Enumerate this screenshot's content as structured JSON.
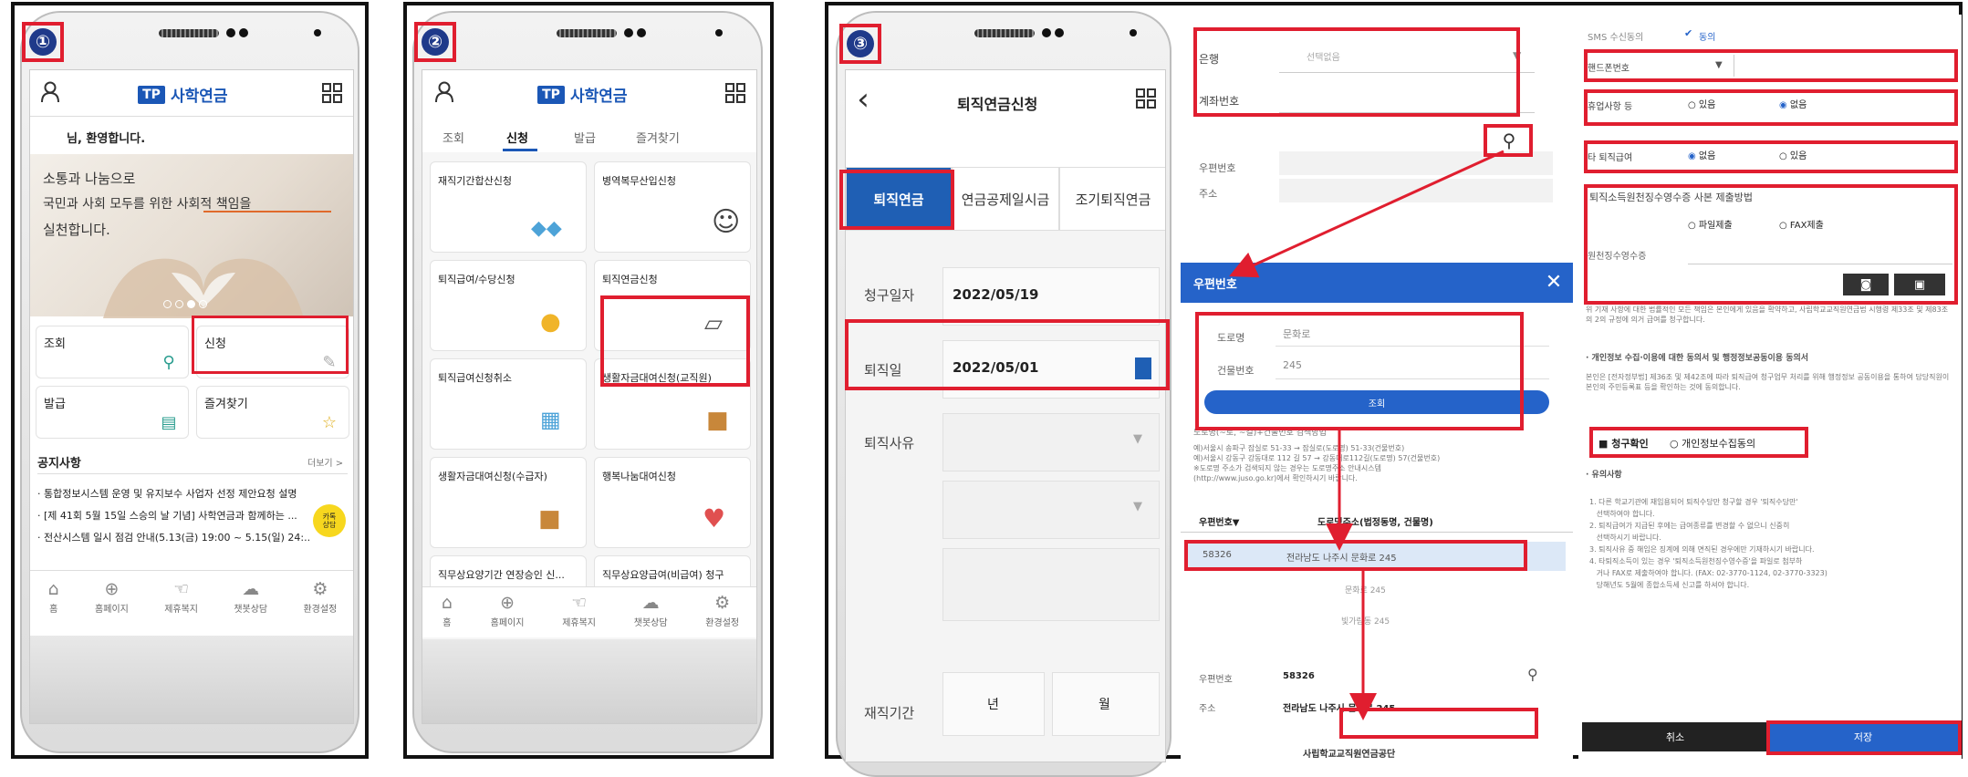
{
  "panel1": {
    "step": "①",
    "logo_mark": "TP",
    "logo_text": "사학연금",
    "greeting": "님, 환영합니다.",
    "banner_lines": [
      "소통과 나눔으로",
      "국민과 사회 모두를 위한 사회적 책임을",
      "실천합니다."
    ],
    "menu": [
      "조회",
      "신청",
      "발급",
      "즐겨찾기"
    ],
    "notice_title": "공지사항",
    "notice_more": "더보기 >",
    "notices": [
      "· 통합정보시스템 운영 및 유지보수 사업자 선정 제안요청 설명",
      "· [제 41회 5월 15일 스승의 날 기념] 사학연금과 함께하는 ...",
      "· 전산시스템 일시 점검 안내(5.13(금) 19:00 ~ 5.15(일) 24:..."
    ],
    "chat_badge": "카톡 상담",
    "nav": [
      "홈",
      "홈페이지",
      "제휴복지",
      "챗봇상담",
      "환경설정"
    ]
  },
  "panel2": {
    "step": "②",
    "logo_mark": "TP",
    "logo_text": "사학연금",
    "tabs": [
      "조회",
      "신청",
      "발급",
      "즐겨찾기"
    ],
    "cards": [
      "재직기간합산신청",
      "병역복무산입신청",
      "퇴직급여/수당신청",
      "퇴직연금신청",
      "퇴직급여신청취소",
      "생활자금대여신청(교직원)",
      "생활자금대여신청(수급자)",
      "행복나눔대여신청",
      "직무상요양기간 연장승인 신...",
      "직무상요양급여(비급여) 청구"
    ],
    "nav": [
      "홈",
      "홈페이지",
      "제휴복지",
      "챗봇상담",
      "환경설정"
    ]
  },
  "panel3": {
    "step": "③",
    "title": "퇴직연금신청",
    "tabs": [
      "퇴직연금",
      "연금공제일시금",
      "조기퇴직연금"
    ],
    "claim_date_label": "청구일자",
    "claim_date": "2022/05/19",
    "retire_date_label": "퇴직일",
    "retire_date": "2022/05/01",
    "reason_label": "퇴직사유",
    "tenure_label": "재직기간",
    "year_unit": "년",
    "month_unit": "월"
  },
  "panel4": {
    "bank_label": "은행",
    "bank_placeholder": "선택없음",
    "account_label": "계좌번호",
    "zip_label": "우편번호",
    "addr_label": "주소",
    "popup_title": "우편번호",
    "road_label": "도로명",
    "road_value": "문화로",
    "bldg_label": "건물번호",
    "bldg_value": "245",
    "search_btn": "조회",
    "help_title": "도로명(~로, ~길)+건물번호 검색방법",
    "help_text": "예)서울시 송파구 잠실로 51-33 → 잠실로(도로명) 51-33(건물번호)\n예)서울시 강동구 강동대로 112 길 57 → 강동대로112길(도로명) 57(건물번호)\n※도로명 주소가 검색되지 않는 경우는 도로명주소 안내시스템\n(http://www.juso.go.kr)에서 확인하시기 바랍니다.",
    "col_zip": "우편번호▼",
    "col_addr": "도로명주소(법정동명, 건물명)",
    "result_zip": "58326",
    "result_addr": "전라남도 나주시 문화로 245",
    "result_sub1": "문화로 245",
    "result_sub2": "빛가람동 245",
    "final_zip_label": "우편번호",
    "final_zip": "58326",
    "final_addr_label": "주소",
    "final_addr": "전라남도 나주시 문화로 245",
    "footer_org": "사립학교교직원연금공단"
  },
  "panel5": {
    "sms_label": "SMS 수신동의",
    "sms_value": "동의",
    "phone_label": "핸드폰번호",
    "q1_label": "휴업사항 등",
    "q1_opt1": "있음",
    "q1_opt2": "없음",
    "q2_label": "타 퇴직급여",
    "q2_opt1": "없음",
    "q2_opt2": "있음",
    "doc_label": "퇴직소득원천징수영수증 사본 제출방법",
    "doc_opt1": "파일제출",
    "doc_opt2": "FAX제출",
    "doc_file_label": "원천징수영수증",
    "agree_text": "위 기재 사항에 대한 법률적인 모든 책임은 본인에게 있음을 확약하고, 사립학교교직원연금법 시행령 제33조 및 제83조의 2의 규정에 의거 급여를 청구합니다.",
    "privacy_title": "· 개인정보 수집·이용에 대한 동의서 및 행정정보공동이용 동의서",
    "privacy_text": "본인은 [전자정부법] 제36조 및 제42조에 따라 퇴직급여 청구업무 처리를 위해 행정정보 공동이용을 통하여 담당직원이 본인의 주민등록표 등을 확인하는 것에 동의합니다.",
    "check1": "청구확인",
    "check2": "개인정보수집동의",
    "notes_title": "· 유의사항",
    "notes_text": "1. 다른 학교기관에 재임용되어 퇴직수당만 청구할 경우 '퇴직수당만'\n   선택하여야 합니다.\n2. 퇴직급여가 지급된 후에는 급여종류를 변경할 수 없으니 신중히\n   선택하시기 바랍니다.\n3. 퇴직사유 중 해임은 징계에 의해 면직된 경우에만 기재하시기 바랍니다.\n4. 타퇴직소득이 있는 경우 '퇴직소득원천징수영수증'을 파일로 첨부하\n   거나 FAX로 제출하여야 합니다. (FAX: 02-3770-1124, 02-3770-3323)\n   당해년도 5월에 종합소득세 신고를 하셔야 합니다.",
    "cancel_btn": "취소",
    "save_btn": "저장"
  }
}
